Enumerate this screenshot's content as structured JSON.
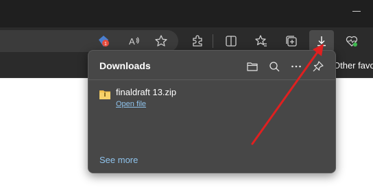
{
  "toolbar": {
    "icons": {
      "extension_badge": "1",
      "read_aloud": "read-aloud-icon",
      "favorite": "star-icon",
      "extensions": "puzzle-icon",
      "split_screen": "split-screen-icon",
      "favorites": "favorites-icon",
      "collections": "collections-icon",
      "downloads": "download-icon",
      "health": "heart-pulse-icon"
    }
  },
  "bookmarks_bar": {
    "other_favorites": "Other favor"
  },
  "downloads_panel": {
    "title": "Downloads",
    "items": [
      {
        "file_name": "finaldraft 13.zip",
        "action_label": "Open file"
      }
    ],
    "see_more_label": "See more"
  },
  "colors": {
    "panel_bg": "#474747",
    "link": "#8fc3ec",
    "arrow": "#e02020",
    "folder": "#f2c14e"
  }
}
